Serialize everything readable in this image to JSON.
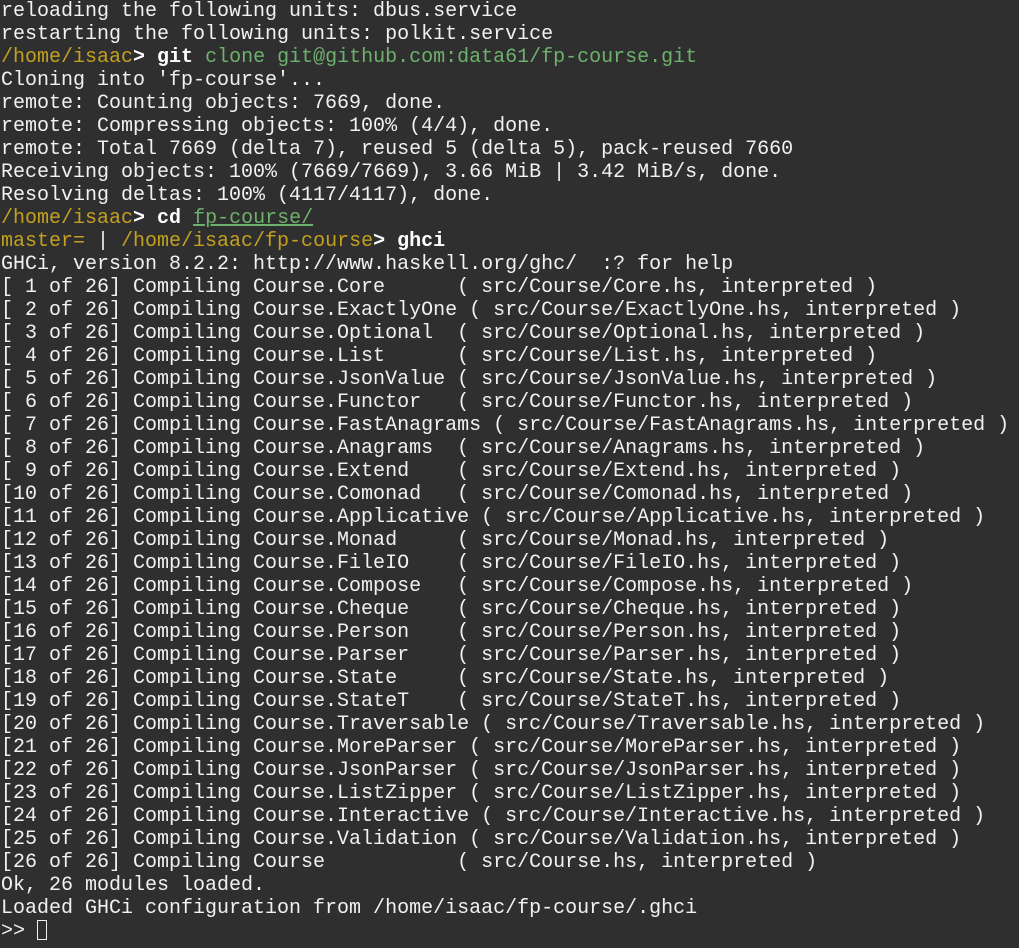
{
  "terminal": {
    "reload_lines": [
      "reloading the following units: dbus.service",
      "restarting the following units: polkit.service"
    ],
    "prompt1": {
      "path": "/home/isaac",
      "symbol": "> ",
      "command": "git",
      "args": " clone git@github.com:data61/fp-course.git"
    },
    "clone_output": [
      "Cloning into 'fp-course'...",
      "remote: Counting objects: 7669, done.",
      "remote: Compressing objects: 100% (4/4), done.",
      "remote: Total 7669 (delta 7), reused 5 (delta 5), pack-reused 7660",
      "Receiving objects: 100% (7669/7669), 3.66 MiB | 3.42 MiB/s, done.",
      "Resolving deltas: 100% (4117/4117), done."
    ],
    "prompt2": {
      "path": "/home/isaac",
      "symbol": "> ",
      "command": "cd",
      "arg": "fp-course/"
    },
    "prompt3": {
      "branch": "master=",
      "separator": " | ",
      "path": "/home/isaac/fp-course",
      "symbol": "> ",
      "command": "ghci"
    },
    "ghci_banner": "GHCi, version 8.2.2: http://www.haskell.org/ghc/  :? for help",
    "compile_lines": [
      "[ 1 of 26] Compiling Course.Core      ( src/Course/Core.hs, interpreted )",
      "[ 2 of 26] Compiling Course.ExactlyOne ( src/Course/ExactlyOne.hs, interpreted )",
      "[ 3 of 26] Compiling Course.Optional  ( src/Course/Optional.hs, interpreted )",
      "[ 4 of 26] Compiling Course.List      ( src/Course/List.hs, interpreted )",
      "[ 5 of 26] Compiling Course.JsonValue ( src/Course/JsonValue.hs, interpreted )",
      "[ 6 of 26] Compiling Course.Functor   ( src/Course/Functor.hs, interpreted )",
      "[ 7 of 26] Compiling Course.FastAnagrams ( src/Course/FastAnagrams.hs, interpreted )",
      "[ 8 of 26] Compiling Course.Anagrams  ( src/Course/Anagrams.hs, interpreted )",
      "[ 9 of 26] Compiling Course.Extend    ( src/Course/Extend.hs, interpreted )",
      "[10 of 26] Compiling Course.Comonad   ( src/Course/Comonad.hs, interpreted )",
      "[11 of 26] Compiling Course.Applicative ( src/Course/Applicative.hs, interpreted )",
      "[12 of 26] Compiling Course.Monad     ( src/Course/Monad.hs, interpreted )",
      "[13 of 26] Compiling Course.FileIO    ( src/Course/FileIO.hs, interpreted )",
      "[14 of 26] Compiling Course.Compose   ( src/Course/Compose.hs, interpreted )",
      "[15 of 26] Compiling Course.Cheque    ( src/Course/Cheque.hs, interpreted )",
      "[16 of 26] Compiling Course.Person    ( src/Course/Person.hs, interpreted )",
      "[17 of 26] Compiling Course.Parser    ( src/Course/Parser.hs, interpreted )",
      "[18 of 26] Compiling Course.State     ( src/Course/State.hs, interpreted )",
      "[19 of 26] Compiling Course.StateT    ( src/Course/StateT.hs, interpreted )",
      "[20 of 26] Compiling Course.Traversable ( src/Course/Traversable.hs, interpreted )",
      "[21 of 26] Compiling Course.MoreParser ( src/Course/MoreParser.hs, interpreted )",
      "[22 of 26] Compiling Course.JsonParser ( src/Course/JsonParser.hs, interpreted )",
      "[23 of 26] Compiling Course.ListZipper ( src/Course/ListZipper.hs, interpreted )",
      "[24 of 26] Compiling Course.Interactive ( src/Course/Interactive.hs, interpreted )",
      "[25 of 26] Compiling Course.Validation ( src/Course/Validation.hs, interpreted )",
      "[26 of 26] Compiling Course           ( src/Course.hs, interpreted )"
    ],
    "ok_line": "Ok, 26 modules loaded.",
    "config_line": "Loaded GHCi configuration from /home/isaac/fp-course/.ghci",
    "ghci_prompt": ">> "
  },
  "colors": {
    "background": "#2f2f2f",
    "foreground": "#f1f1f1",
    "path": "#c3a020",
    "argument": "#6db16d"
  }
}
